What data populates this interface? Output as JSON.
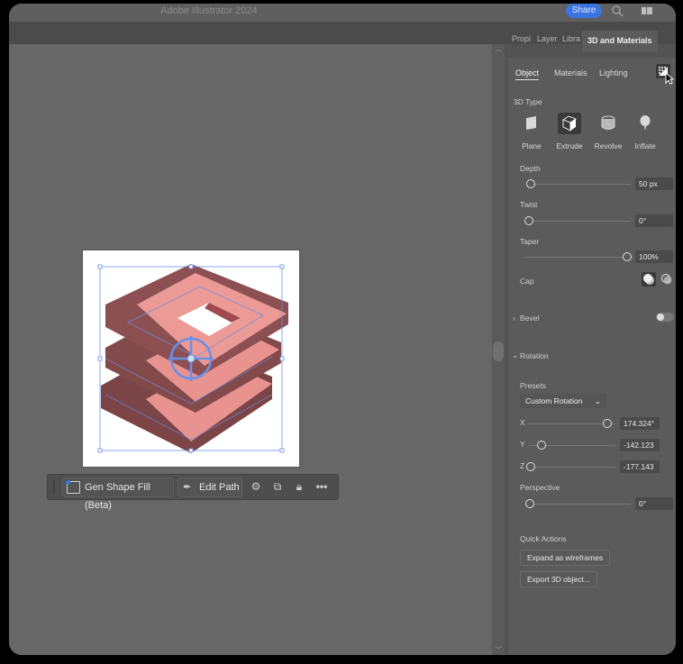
{
  "app": {
    "title": "Adobe Illustrator 2024",
    "share_label": "Share"
  },
  "colors": {
    "accent": "#3b74e0",
    "object_pink": "#e8938f",
    "object_shadow": "#8a4a4c",
    "selection_blue": "#6a8fe8"
  },
  "panel_tabs": [
    {
      "label": "Propi",
      "active": false
    },
    {
      "label": "Layer",
      "active": false
    },
    {
      "label": "Libra",
      "active": false
    },
    {
      "label": "3D and Materials",
      "active": true
    }
  ],
  "sub_tabs": [
    {
      "label": "Object",
      "active": true
    },
    {
      "label": "Materials",
      "active": false
    },
    {
      "label": "Lighting",
      "active": false
    }
  ],
  "object": {
    "type_heading": "3D Type",
    "types": [
      {
        "label": "Plane",
        "icon": "plane-icon",
        "active": false
      },
      {
        "label": "Extrude",
        "icon": "extrude-icon",
        "active": true
      },
      {
        "label": "Revolve",
        "icon": "revolve-icon",
        "active": false
      },
      {
        "label": "Inflate",
        "icon": "inflate-icon",
        "active": false
      }
    ],
    "depth": {
      "label": "Depth",
      "value": "50 px",
      "fraction": 0.0
    },
    "twist": {
      "label": "Twist",
      "value": "0°",
      "fraction": 0.0
    },
    "taper": {
      "label": "Taper",
      "value": "100%",
      "fraction": 1.0
    },
    "cap": {
      "label": "Cap"
    },
    "bevel": {
      "label": "Bevel",
      "enabled": false
    },
    "rotation": {
      "label": "Rotation",
      "presets_label": "Presets",
      "preset_value": "Custom Rotation",
      "x": {
        "label": "X",
        "value": "174.324°",
        "fraction": 0.97
      },
      "y": {
        "label": "Y",
        "value": "-142.123",
        "fraction": 0.1
      },
      "z": {
        "label": "Z",
        "value": "-177.143",
        "fraction": 0.0
      }
    },
    "perspective": {
      "label": "Perspective",
      "value": "0°",
      "fraction": 0.0
    },
    "quick_actions": {
      "label": "Quick Actions",
      "buttons": [
        "Expand as wireframes",
        "Export 3D object..."
      ]
    }
  },
  "context_bar": {
    "gen_shape_fill": "Gen Shape Fill (Beta)",
    "edit_path": "Edit Path"
  }
}
